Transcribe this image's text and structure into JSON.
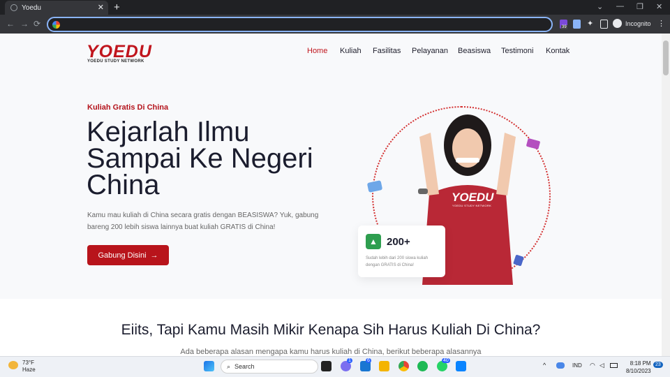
{
  "browser": {
    "tab_title": "Yoedu",
    "tab_close": "✕",
    "new_tab": "+",
    "minimize": "⌄",
    "window_min": "—",
    "window_restore": "❐",
    "window_close": "✕",
    "back": "←",
    "forward": "→",
    "reload": "⟳",
    "ext_badge": "39",
    "incognito_label": "Incognito",
    "menu": "⋮"
  },
  "site": {
    "logo": "YOEDU",
    "logo_sub": "YOEDU STUDY NETWORK",
    "nav": [
      "Home",
      "Kuliah",
      "Fasilitas",
      "Pelayanan",
      "Beasiswa",
      "Testimoni",
      "Kontak"
    ],
    "active_nav": "Home"
  },
  "hero": {
    "eyebrow": "Kuliah Gratis Di China",
    "title": "Kejarlah Ilmu Sampai Ke Negeri China",
    "lead": "Kamu mau kuliah di China secara gratis dengan BEASISWA? Yuk, gabung bareng 200 lebih siswa lainnya buat kuliah GRATIS di China!",
    "cta": "Gabung Disini",
    "cta_icon": "→",
    "card_number": "200+",
    "card_text": "Sudah lebih dari 200 siswa kuliah dengan GRATIS di China!",
    "shirt_logo": "YOEDU",
    "shirt_sub": "YOEDU STUDY NETWORK"
  },
  "section2": {
    "title": "Eiits, Tapi Kamu Masih Mikir Kenapa Sih Harus Kuliah Di China?",
    "subtitle": "Ada beberapa alasan mengapa kamu harus kuliah di China, berikut beberapa alasannya"
  },
  "taskbar": {
    "temp": "73°F",
    "condition": "Haze",
    "search_placeholder": "Search",
    "badge_teams": "1",
    "badge_mail": "6",
    "badge_whatsapp": "40",
    "lang": "IND",
    "time": "8:18 PM",
    "date": "8/10/2023",
    "notif_count": "23"
  },
  "colors": {
    "brand_red": "#c0151d",
    "accent_green": "#2e9e4f",
    "chrome_dark": "#202124",
    "focus_blue": "#8ab4f8"
  }
}
